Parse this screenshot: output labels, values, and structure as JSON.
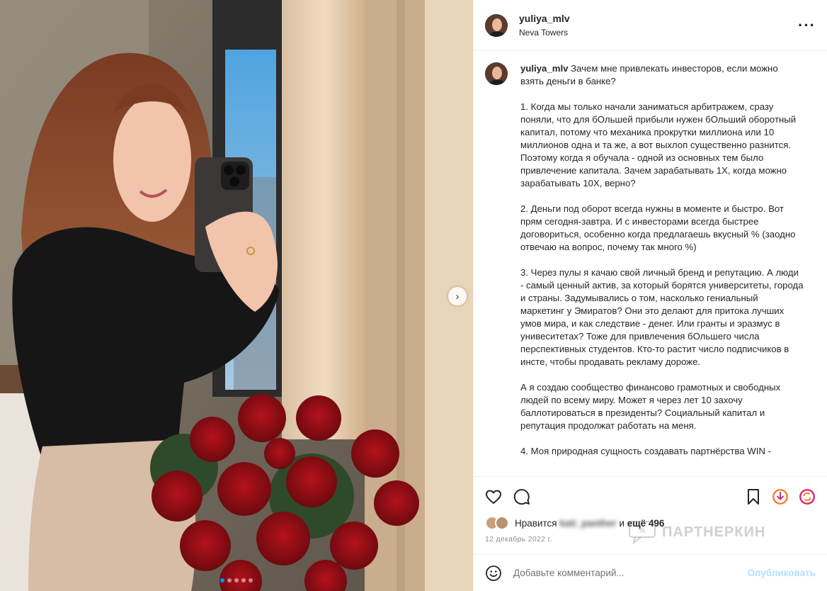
{
  "post": {
    "username": "yuliya_mlv",
    "location": "Neva Towers",
    "more_icon": "more-horizontal-icon",
    "next_icon": "chevron-right-icon",
    "carousel": {
      "count": 5,
      "active": 1
    }
  },
  "caption": {
    "username": "yuliya_mlv",
    "paragraphs": [
      "Зачем мне привлекать инвесторов, если можно взять деньги в банке?",
      "1. Когда мы только начали заниматься арбитражем, сразу поняли, что для бОльшей прибыли нужен бОльший оборотный капитал, потому что механика прокрутки миллиона или 10 миллионов одна и та же, а вот выхлоп существенно разнится. Поэтому когда я обучала - одной из основных тем было привлечение капитала. Зачем зарабатывать 1Х, когда можно зарабатывать 10Х, верно?",
      "2. Деньги под оборот всегда нужны в моменте и быстро. Вот прям сегодня-завтра. И с инвесторами всегда быстрее договориться, особенно когда предлагаешь вкусный % (заодно отвечаю на вопрос, почему так много %)",
      "3. Через пулы я качаю свой личный бренд и репутацию. А люди - самый ценный актив, за который борятся университеты, города и страны. Задумывались о том, насколько гениальный маркетинг у Эмиратов? Они это делают для притока лучших умов мира, и как следствие - денег. Или гранты и эразмус в унивеситетах? Тоже для привлечения бОльшего числа перспективных студентов. Кто-то растит число подписчиков в инсте, чтобы продавать рекламу дороже.",
      "А я создаю сообщество финансово грамотных и свободных людей по всему миру. Может я через лет 10 захочу баллотироваться в президенты? Социальный капитал и репутация продолжат работать на меня.",
      "4. Моя природная сущность создавать партнёрства WIN -"
    ]
  },
  "actions": {
    "like_icon": "heart-icon",
    "comment_icon": "comment-icon",
    "save_icon": "bookmark-icon",
    "download_icon": "download-icon",
    "repost_icon": "repost-icon"
  },
  "likes": {
    "prefix": "Нравится",
    "user": "kati_panther",
    "suffix": "и",
    "others": "ещё 496"
  },
  "date": "12 декабрь 2022 г.",
  "watermark": "ПАРТНЕРКИН",
  "comment": {
    "emoji_icon": "smiley-icon",
    "placeholder": "Добавьте комментарий...",
    "publish": "Опубликовать"
  }
}
